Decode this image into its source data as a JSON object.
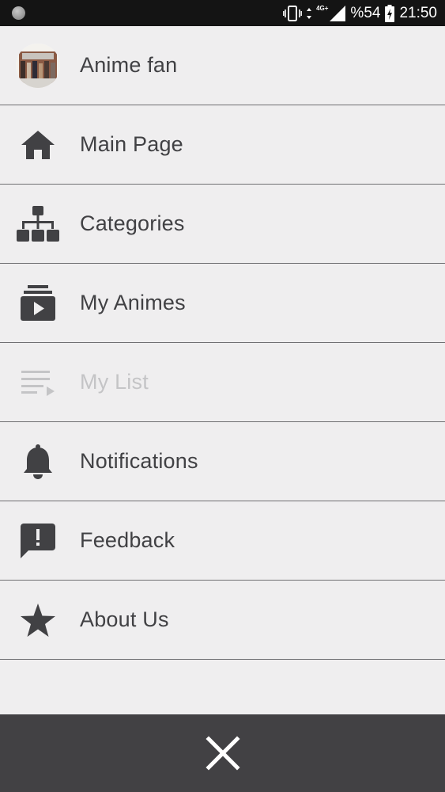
{
  "status_bar": {
    "network": "4G+",
    "battery": "%54",
    "time": "21:50",
    "icons": [
      "notification-dot-icon",
      "vibrate-icon",
      "data-arrows-icon",
      "signal-icon",
      "battery-charging-icon"
    ]
  },
  "menu": {
    "items": [
      {
        "label": "Anime fan",
        "icon": "profile-avatar",
        "enabled": true
      },
      {
        "label": "Main Page",
        "icon": "home-icon",
        "enabled": true
      },
      {
        "label": "Categories",
        "icon": "sitemap-icon",
        "enabled": true
      },
      {
        "label": "My Animes",
        "icon": "video-library-icon",
        "enabled": true
      },
      {
        "label": "My List",
        "icon": "playlist-play-icon",
        "enabled": false
      },
      {
        "label": "Notifications",
        "icon": "bell-icon",
        "enabled": true
      },
      {
        "label": "Feedback",
        "icon": "feedback-icon",
        "enabled": true
      },
      {
        "label": "About Us",
        "icon": "star-icon",
        "enabled": true
      }
    ]
  },
  "bottom_bar": {
    "close_icon": "close-icon"
  },
  "colors": {
    "background": "#efeeef",
    "text": "#414144",
    "disabled_text": "#c4c4c6",
    "divider": "#6f6f72",
    "bottom_bar": "#424144",
    "status_bar": "#141414"
  }
}
